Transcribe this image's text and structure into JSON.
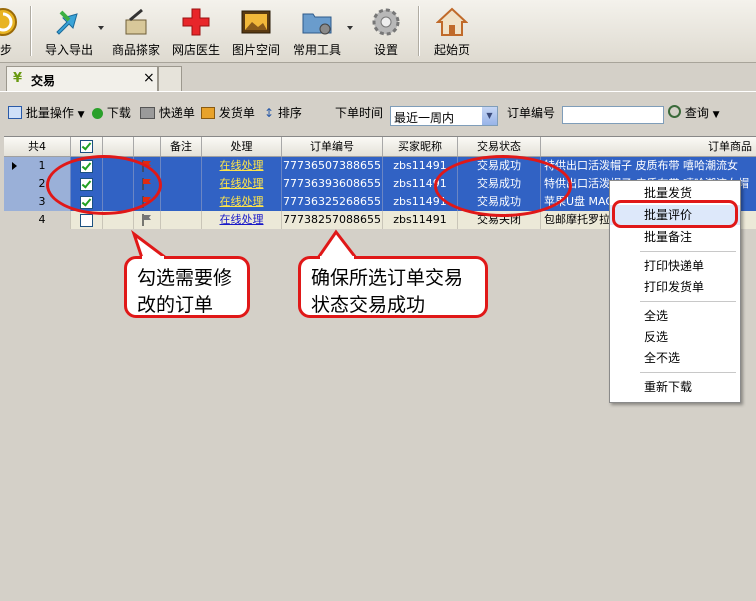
{
  "toolbar": {
    "items": [
      {
        "label": "步"
      },
      {
        "label": "导入导出"
      },
      {
        "label": "商品搽家"
      },
      {
        "label": "网店医生"
      },
      {
        "label": "图片空间"
      },
      {
        "label": "常用工具"
      },
      {
        "label": "设置"
      },
      {
        "label": "起始页"
      }
    ]
  },
  "tabs": [
    {
      "label": "交易",
      "close": "×"
    }
  ],
  "subbar": {
    "batch_label": "批量操作",
    "download_label": "下载",
    "express_label": "快递单",
    "ship_label": "发货单",
    "sort_label": "排序",
    "time_label": "下单时间",
    "time_value": "最近一周内",
    "order_no_label": "订单编号",
    "order_no_value": "",
    "query_label": "查询"
  },
  "grid": {
    "headers": [
      "共4",
      "",
      "",
      "备注",
      "处理",
      "订单编号",
      "买家昵称",
      "交易状态",
      "订单商品"
    ],
    "rows": [
      {
        "num": "1",
        "checked": true,
        "selected": true,
        "flag": "red",
        "action": "在线处理",
        "order_no": "77736507388655",
        "buyer": "zbs11491",
        "status": "交易成功",
        "product": "特供出口活泼帽子 皮质布带 嘻哈潮流女"
      },
      {
        "num": "2",
        "checked": true,
        "selected": true,
        "flag": "red",
        "action": "在线处理",
        "order_no": "77736393608655",
        "buyer": "zbs11491",
        "status": "交易成功",
        "product": "特供出口活泼帽子 皮质布带 嘻哈潮流女帽"
      },
      {
        "num": "3",
        "checked": true,
        "selected": true,
        "flag": "red",
        "action": "在线处理",
        "order_no": "77736325268655",
        "buyer": "zbs11491",
        "status": "交易成功",
        "product": "苹果U盘 MAC"
      },
      {
        "num": "4",
        "checked": false,
        "selected": false,
        "flag": "gray",
        "action": "在线处理",
        "order_no": "77738257088655",
        "buyer": "zbs11491",
        "status": "交易关闭",
        "product": "包邮摩托罗拉 4G"
      }
    ]
  },
  "context_menu": {
    "items": [
      "批量发货",
      "批量评价",
      "批量备注",
      "打印快递单",
      "打印发货单",
      "全选",
      "反选",
      "全不选",
      "重新下载"
    ],
    "highlighted": "批量评价"
  },
  "callouts": {
    "left": "勾选需要修改的订单",
    "right": "确保所选订单交易状态交易成功"
  },
  "colors": {
    "selection": "#3162c4",
    "annotation": "#e01818",
    "link_on_selection": "#ffe54a"
  }
}
